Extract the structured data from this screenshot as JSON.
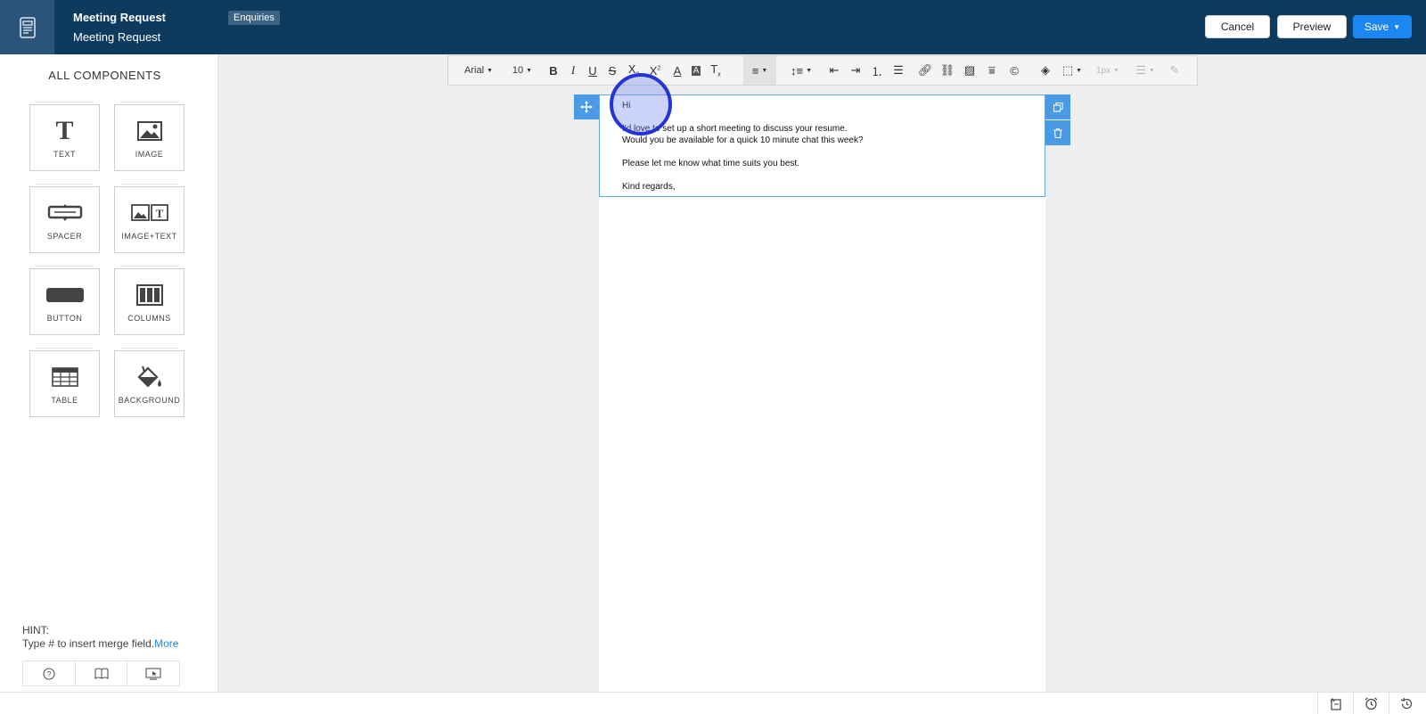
{
  "header": {
    "title": "Meeting Request",
    "subtitle": "Meeting Request",
    "tag": "Enquiries",
    "buttons": {
      "cancel": "Cancel",
      "preview": "Preview",
      "save": "Save"
    },
    "colors": {
      "bar": "#0e3a5e",
      "accent": "#1c86f2"
    }
  },
  "sidebar": {
    "title": "ALL COMPONENTS",
    "components": [
      {
        "label": "TEXT",
        "icon": "text-icon"
      },
      {
        "label": "IMAGE",
        "icon": "image-icon"
      },
      {
        "label": "SPACER",
        "icon": "spacer-icon"
      },
      {
        "label": "IMAGE+TEXT",
        "icon": "image-text-icon"
      },
      {
        "label": "BUTTON",
        "icon": "button-icon"
      },
      {
        "label": "COLUMNS",
        "icon": "columns-icon"
      },
      {
        "label": "TABLE",
        "icon": "table-icon"
      },
      {
        "label": "BACKGROUND",
        "icon": "background-icon"
      }
    ],
    "hint": {
      "head": "HINT:",
      "text": "Type # to insert merge field.",
      "more": "More"
    }
  },
  "toolbar": {
    "font": "Arial",
    "size": "10",
    "border_width": "1px"
  },
  "email": {
    "lines": [
      "Hi",
      "I'd love to set up a short meeting to discuss your resume.",
      "Would you be available for a quick 10 minute chat this week?",
      "Please let me know what time suits you best.",
      "Kind regards,"
    ]
  }
}
